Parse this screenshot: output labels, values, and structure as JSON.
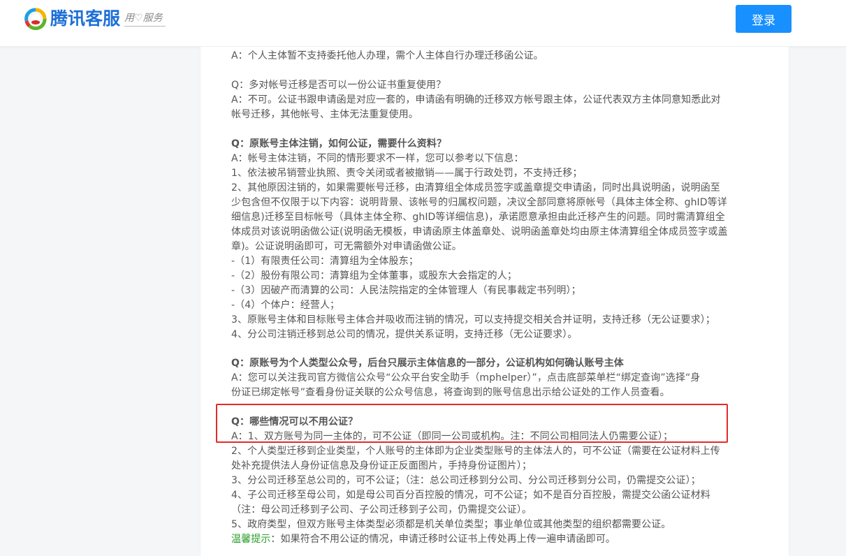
{
  "header": {
    "logo_text": "腾讯客服",
    "slogan": "用♡服务",
    "login_label": "登录"
  },
  "article": {
    "lines": [
      "A：个人主体暂不支持委托他人办理，需个人主体自行办理迁移函公证。",
      "Q：多对帐号迁移是否可以一份公证书重复使用？",
      "A：不可。公证书跟申请函是对应一套的，申请函有明确的迁移双方帐号跟主体，公证代表双方主体同意知悉此对",
      "帐号迁移，其他帐号、主体无法重复使用。",
      "Q：原账号主体注销，如何公证，需要什么资料？",
      "A：帐号主体注销，不同的情形要求不一样，您可以参考以下信息：",
      "1、依法被吊销营业执照、责令关闭或者被撤销——属于行政处罚，不支持迁移；",
      "2、其他原因注销的，如果需要帐号迁移，由清算组全体成员签字或盖章提交申请函，同时出具说明函，说明函至",
      "少包含但不仅限于以下内容：说明背景、该帐号的归属权问题，决议全部同意将原帐号（具体主体全称、ghID等详",
      "细信息)迁移至目标帐号（具体主体全称、ghID等详细信息)，承诺愿意承担由此迁移产生的问题。同时需清算组全",
      "体成员对该说明函做公证(说明函无模板，申请函原主体盖章处、说明函盖章处均由原主体清算组全体成员签字或盖",
      "章)。公证说明函即可，可无需额外对申请函做公证。",
      "-（1）有限责任公司：清算组为全体股东；",
      "-（2）股份有限公司：清算组为全体董事，或股东大会指定的人；",
      "-（3）因破产而清算的公司：人民法院指定的全体管理人（有民事裁定书列明）；",
      "-（4）个体户：经营人；",
      "3、原账号主体和目标账号主体合并吸收而注销的情况，可以支持提交相关合并证明，支持迁移（无公证要求）；",
      "4、分公司注销迁移到总公司的情况，提供关系证明，支持迁移（无公证要求）。",
      "Q：原账号为个人类型公众号，后台只展示主体信息的一部分，公证机构如何确认账号主体",
      "A：您可以关注我司官方微信公众号“公众平台安全助手（mphelper）”，点击底部菜单栏“绑定查询”选择“身",
      "份证已绑定帐号”查看身份证关联的公众号信息，将查询到的账号信息出示给公证处的工作人员查看。",
      "Q：哪些情况可以不用公证？",
      "A：1、双方账号为同一主体的，可不公证（即同一公司或机构。注：不同公司相同法人仍需要公证）；",
      "2、个人类型迁移到企业类型，个人账号的主体即为企业类型账号的主体法人的，可不公证（需要在公证材料上传",
      "处补充提供法人身份证信息及身份证正反面图片，手持身份证图片）；",
      "3、分公司迁移至总公司的，可不公证；（注：总公司迁移到分公司、分公司迁移到分公司，仍需提交公证）；",
      "4、子公司迁移至母公司，如是母公司百分百控股的情况，可不公证；如不是百分百控股，需提交公函公证材料",
      "（注：母公司迁移到子公司、子公司迁移到子公司，仍需提交公证）。",
      "5、政府类型，但双方账号主体类型必须都是机关单位类型；事业单位或其他类型的组织都需要公证。"
    ],
    "tip_label": "温馨提示",
    "tip_text": "：如果符合不用公证的情况，申请迁移时公证书上传处再上传一遍申请函即可。"
  },
  "colors": {
    "primary": "#1890ff",
    "highlight_border": "#e52a2a",
    "tip": "#2a9d2a"
  }
}
